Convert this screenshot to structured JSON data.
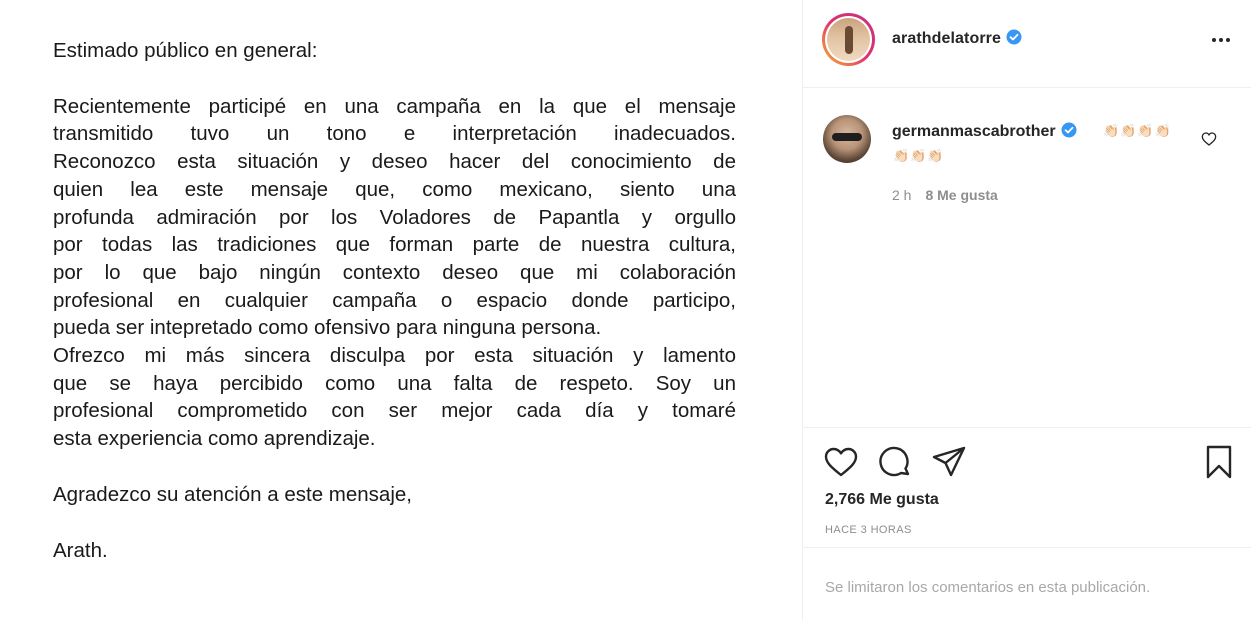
{
  "letter": {
    "greeting": "Estimado público en general:",
    "body_lines": [
      "Recientemente participé en una campaña en la que el mensaje",
      "transmitido tuvo un tono e interpretación inadecuados.",
      "Reconozco esta situación y deseo hacer del conocimiento de",
      "quien lea este mensaje que, como mexicano, siento una",
      "profunda admiración por los Voladores de Papantla y orgullo",
      "por todas las tradiciones que forman parte de nuestra cultura,",
      "por lo que bajo ningún contexto deseo que mi colaboración",
      "profesional en cualquier campaña o espacio donde participo,",
      "pueda ser intepretado como ofensivo para ninguna persona.",
      "Ofrezco mi más sincera disculpa por esta situación y lamento",
      "que se haya percibido como una falta de respeto. Soy un",
      "profesional comprometido con ser mejor cada día y tomaré",
      "esta experiencia como aprendizaje."
    ],
    "closing": "Agradezco su atención a este mensaje,",
    "signature": "Arath."
  },
  "header": {
    "username": "arathdelatorre",
    "verified": true,
    "more_icon": "more-horizontal-icon"
  },
  "comment": {
    "username": "germanmascabrother",
    "verified": true,
    "emoji_line_1": "👏🏻👏🏻👏🏻👏🏻",
    "emoji_line_2": "👏🏻👏🏻👏🏻",
    "time": "2 h",
    "likes": "8 Me gusta"
  },
  "actions": {
    "icons": [
      "heart-icon",
      "comment-icon",
      "share-icon",
      "bookmark-icon"
    ],
    "likes_count": "2,766 Me gusta",
    "timestamp": "HACE 3 HORAS"
  },
  "comments_notice": "Se limitaron los comentarios en esta publicación.",
  "colors": {
    "verified_blue": "#3897f0",
    "text_primary": "#262626",
    "text_secondary": "#8e8e8e",
    "divider": "#efefef"
  }
}
